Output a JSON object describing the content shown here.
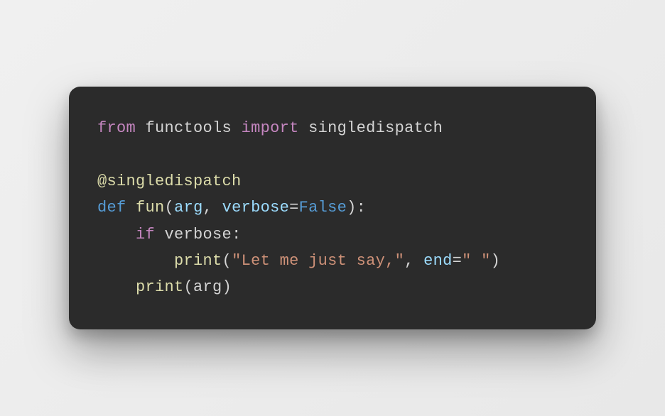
{
  "code": {
    "line1": {
      "from": "from",
      "module": "functools",
      "import": "import",
      "name": "singledispatch"
    },
    "line3": {
      "at": "@",
      "decorator": "singledispatch"
    },
    "line4": {
      "def": "def",
      "funcname": "fun",
      "open": "(",
      "arg1": "arg",
      "comma": ", ",
      "arg2": "verbose",
      "eq": "=",
      "false": "False",
      "close": "):"
    },
    "line5": {
      "indent": "    ",
      "if": "if",
      "space": " ",
      "cond": "verbose",
      "colon": ":"
    },
    "line6": {
      "indent": "        ",
      "print": "print",
      "open": "(",
      "str": "\"Let me just say,\"",
      "comma": ", ",
      "kwarg": "end",
      "eq": "=",
      "strval": "\" \"",
      "close": ")"
    },
    "line7": {
      "indent": "    ",
      "print": "print",
      "open": "(",
      "arg": "arg",
      "close": ")"
    }
  }
}
